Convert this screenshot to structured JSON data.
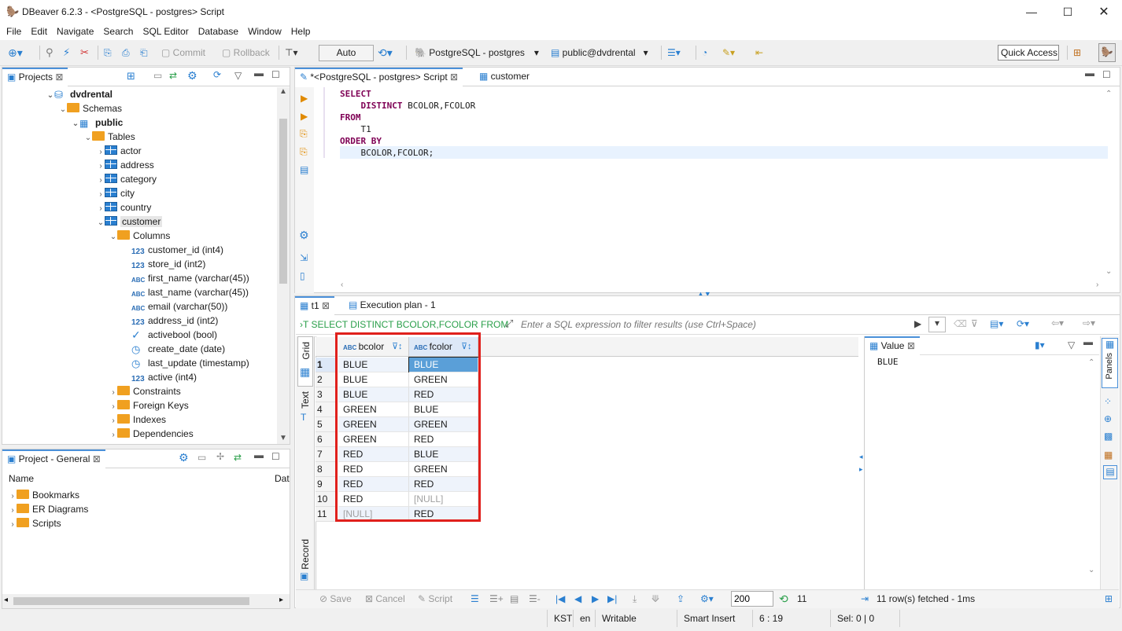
{
  "window": {
    "title": "DBeaver 6.2.3 - <PostgreSQL - postgres> Script"
  },
  "menu": [
    "File",
    "Edit",
    "Navigate",
    "Search",
    "SQL Editor",
    "Database",
    "Window",
    "Help"
  ],
  "toolbar": {
    "commit": "Commit",
    "rollback": "Rollback",
    "mode": "Auto",
    "connection": "PostgreSQL - postgres",
    "schema": "public@dvdrental",
    "quick_access": "Quick Access"
  },
  "projects_panel": {
    "tab": "Projects",
    "tree": [
      {
        "label": "dvdrental",
        "kind": "db"
      },
      {
        "label": "Schemas",
        "kind": "folder"
      },
      {
        "label": "public",
        "kind": "schema"
      },
      {
        "label": "Tables",
        "kind": "folder"
      },
      {
        "label": "actor",
        "kind": "table"
      },
      {
        "label": "address",
        "kind": "table"
      },
      {
        "label": "category",
        "kind": "table"
      },
      {
        "label": "city",
        "kind": "table"
      },
      {
        "label": "country",
        "kind": "table"
      },
      {
        "label": "customer",
        "kind": "table"
      },
      {
        "label": "Columns",
        "kind": "folder"
      },
      {
        "label": "customer_id (int4)",
        "kind": "num"
      },
      {
        "label": "store_id (int2)",
        "kind": "num"
      },
      {
        "label": "first_name (varchar(45))",
        "kind": "abc"
      },
      {
        "label": "last_name (varchar(45))",
        "kind": "abc"
      },
      {
        "label": "email (varchar(50))",
        "kind": "abc"
      },
      {
        "label": "address_id (int2)",
        "kind": "num"
      },
      {
        "label": "activebool (bool)",
        "kind": "bool"
      },
      {
        "label": "create_date (date)",
        "kind": "date"
      },
      {
        "label": "last_update (timestamp)",
        "kind": "date"
      },
      {
        "label": "active (int4)",
        "kind": "num"
      },
      {
        "label": "Constraints",
        "kind": "folder"
      },
      {
        "label": "Foreign Keys",
        "kind": "folder"
      },
      {
        "label": "Indexes",
        "kind": "folder"
      },
      {
        "label": "Dependencies",
        "kind": "folder"
      }
    ]
  },
  "general_panel": {
    "tab": "Project - General",
    "col_name": "Name",
    "col_trunc": "Dat",
    "items": [
      "Bookmarks",
      "ER Diagrams",
      "Scripts"
    ]
  },
  "editor": {
    "tabs": [
      "*<PostgreSQL - postgres> Script",
      "customer"
    ],
    "sql_lines": [
      {
        "kw": "SELECT",
        "rest": ""
      },
      {
        "kw": "    DISTINCT",
        "rest": " BCOLOR,FCOLOR"
      },
      {
        "kw": "FROM",
        "rest": ""
      },
      {
        "kw": "",
        "rest": "    T1"
      },
      {
        "kw": "ORDER BY",
        "rest": ""
      },
      {
        "kw": "",
        "rest": "    BCOLOR,FCOLOR;"
      }
    ]
  },
  "results": {
    "tabs": [
      "t1",
      "Execution plan - 1"
    ],
    "query_label": "SELECT DISTINCT BCOLOR,FCOLOR FROM",
    "filter_placeholder": "Enter a SQL expression to filter results (use Ctrl+Space)",
    "side_tabs": [
      "Grid",
      "Text",
      "Record"
    ],
    "columns": [
      "bcolor",
      "fcolor"
    ],
    "rows": [
      [
        "1",
        "BLUE",
        "BLUE"
      ],
      [
        "2",
        "BLUE",
        "GREEN"
      ],
      [
        "3",
        "BLUE",
        "RED"
      ],
      [
        "4",
        "GREEN",
        "BLUE"
      ],
      [
        "5",
        "GREEN",
        "GREEN"
      ],
      [
        "6",
        "GREEN",
        "RED"
      ],
      [
        "7",
        "RED",
        "BLUE"
      ],
      [
        "8",
        "RED",
        "GREEN"
      ],
      [
        "9",
        "RED",
        "RED"
      ],
      [
        "10",
        "RED",
        "[NULL]"
      ],
      [
        "11",
        "[NULL]",
        "RED"
      ]
    ],
    "value_panel": {
      "tab": "Value",
      "content": "BLUE"
    },
    "panels_label": "Panels",
    "bottom": {
      "save": "Save",
      "cancel": "Cancel",
      "script": "Script",
      "fetch_size": "200",
      "row_count": "11",
      "status": "11 row(s) fetched - 1ms"
    }
  },
  "statusbar": {
    "tz": "KST",
    "lang": "en",
    "mode": "Writable",
    "insert": "Smart Insert",
    "position": "6 : 19",
    "selection": "Sel: 0 | 0"
  },
  "colors": {
    "highlight_box": "#e0201c",
    "keyword": "#7f0055",
    "selected_cell": "#5a9fd8",
    "row_alt": "#eef3fb"
  }
}
